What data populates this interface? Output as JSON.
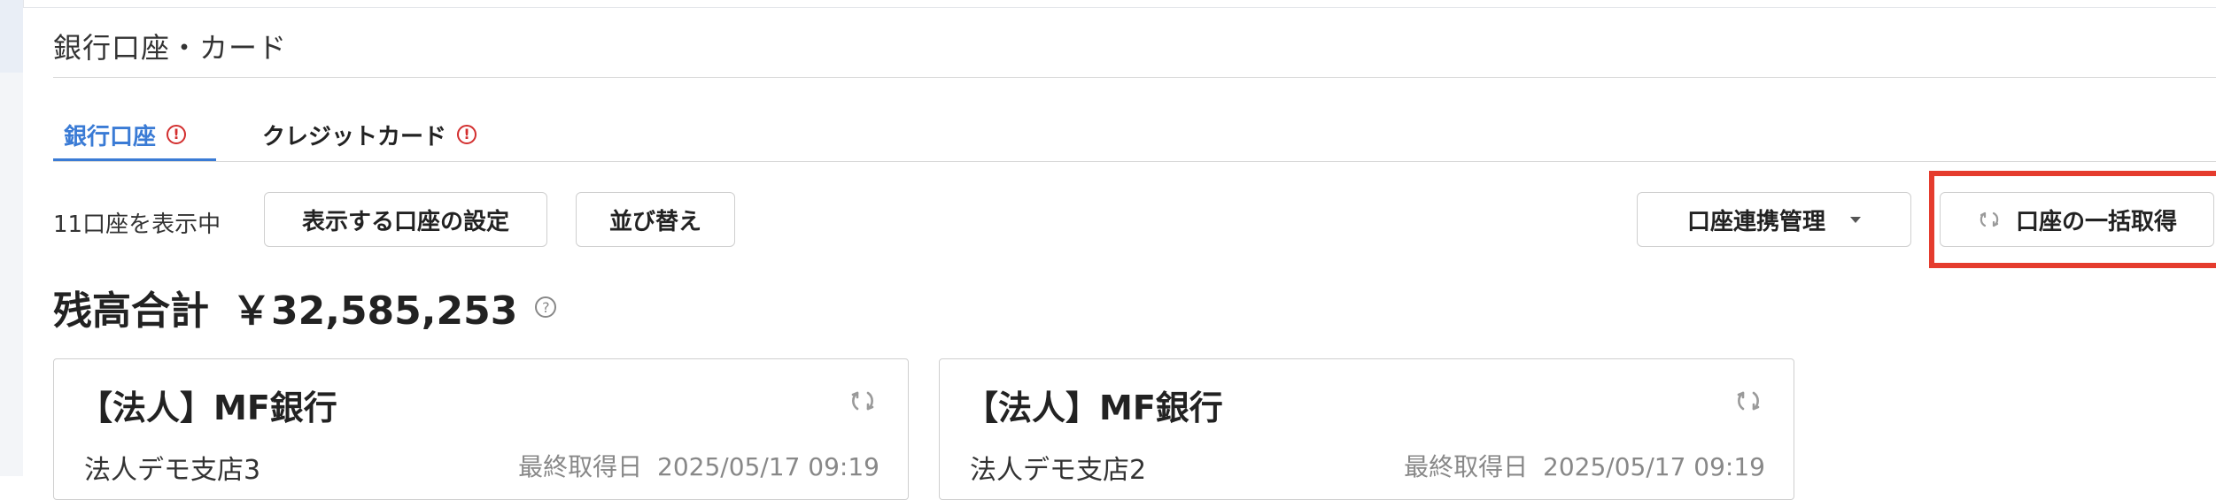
{
  "page": {
    "title": "銀行口座・カード"
  },
  "tabs": [
    {
      "label": "銀行口座",
      "alert": "!"
    },
    {
      "label": "クレジットカード",
      "alert": "!"
    }
  ],
  "toolbar": {
    "count_text": "11口座を表示中",
    "settings_label": "表示する口座の設定",
    "sort_label": "並び替え",
    "link_manage_label": "口座連携管理",
    "bulk_fetch_label": "口座の一括取得"
  },
  "balance": {
    "label": "残高合計",
    "amount": "￥32,585,253",
    "help": "?"
  },
  "accounts": [
    {
      "bank": "【法人】MF銀行",
      "branch": "法人デモ支店3",
      "updated_label": "最終取得日",
      "updated_at": "2025/05/17 09:19"
    },
    {
      "bank": "【法人】MF銀行",
      "branch": "法人デモ支店2",
      "updated_label": "最終取得日",
      "updated_at": "2025/05/17 09:19"
    }
  ],
  "colors": {
    "accent": "#3a7bd5",
    "alert": "#d32f2f",
    "highlight": "#e53c2e"
  },
  "icons": {
    "refresh": "refresh-icon",
    "caret": "caret-down-icon",
    "alert": "alert-circle-icon",
    "help": "help-circle-icon"
  }
}
